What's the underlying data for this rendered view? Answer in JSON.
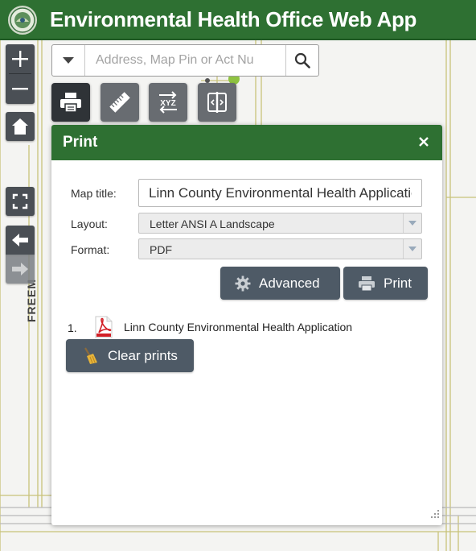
{
  "header": {
    "title": "Environmental Health Office Web App"
  },
  "map": {
    "street_label": "FREEM"
  },
  "map_controls": {
    "zoom_in": "+",
    "zoom_out": "−"
  },
  "search": {
    "placeholder": "Address, Map Pin or Act Nu",
    "value": ""
  },
  "toolbar": {
    "tools": [
      "print-icon",
      "ruler-icon",
      "coordinate-xyz-icon",
      "swipe-icon"
    ],
    "xyz_text": "XYZ"
  },
  "print_panel": {
    "title": "Print",
    "close_glyph": "×",
    "map_title_label": "Map title:",
    "map_title_value": "Linn County Environmental Health Application",
    "layout_label": "Layout:",
    "layout_value": "Letter ANSI A Landscape",
    "format_label": "Format:",
    "format_value": "PDF",
    "advanced_label": "Advanced",
    "print_label": "Print",
    "results": [
      {
        "number": "1.",
        "name": "Linn County Environmental Health Application"
      }
    ],
    "clear_label": "Clear prints"
  },
  "colors": {
    "brand_green": "#2e7032",
    "button_dark": "#4e5a66",
    "tool_gray": "#686c71"
  }
}
